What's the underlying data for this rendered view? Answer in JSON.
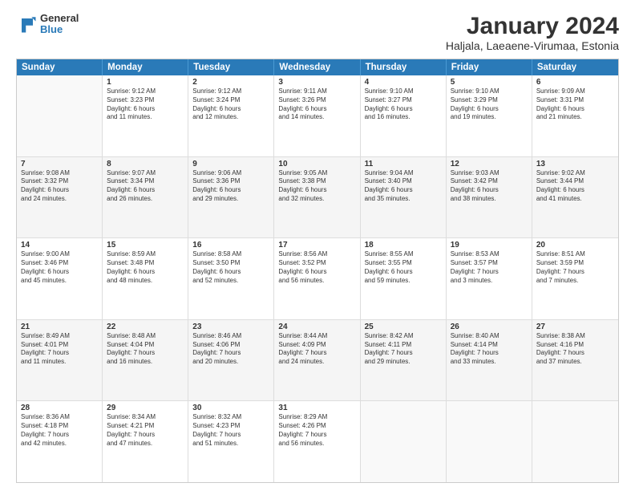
{
  "header": {
    "logo": {
      "general": "General",
      "blue": "Blue"
    },
    "title": "January 2024",
    "location": "Haljala, Laeaene-Virumaa, Estonia"
  },
  "calendar": {
    "days": [
      "Sunday",
      "Monday",
      "Tuesday",
      "Wednesday",
      "Thursday",
      "Friday",
      "Saturday"
    ],
    "rows": [
      [
        {
          "day": "",
          "info": ""
        },
        {
          "day": "1",
          "info": "Sunrise: 9:12 AM\nSunset: 3:23 PM\nDaylight: 6 hours\nand 11 minutes."
        },
        {
          "day": "2",
          "info": "Sunrise: 9:12 AM\nSunset: 3:24 PM\nDaylight: 6 hours\nand 12 minutes."
        },
        {
          "day": "3",
          "info": "Sunrise: 9:11 AM\nSunset: 3:26 PM\nDaylight: 6 hours\nand 14 minutes."
        },
        {
          "day": "4",
          "info": "Sunrise: 9:10 AM\nSunset: 3:27 PM\nDaylight: 6 hours\nand 16 minutes."
        },
        {
          "day": "5",
          "info": "Sunrise: 9:10 AM\nSunset: 3:29 PM\nDaylight: 6 hours\nand 19 minutes."
        },
        {
          "day": "6",
          "info": "Sunrise: 9:09 AM\nSunset: 3:31 PM\nDaylight: 6 hours\nand 21 minutes."
        }
      ],
      [
        {
          "day": "7",
          "info": "Sunrise: 9:08 AM\nSunset: 3:32 PM\nDaylight: 6 hours\nand 24 minutes."
        },
        {
          "day": "8",
          "info": "Sunrise: 9:07 AM\nSunset: 3:34 PM\nDaylight: 6 hours\nand 26 minutes."
        },
        {
          "day": "9",
          "info": "Sunrise: 9:06 AM\nSunset: 3:36 PM\nDaylight: 6 hours\nand 29 minutes."
        },
        {
          "day": "10",
          "info": "Sunrise: 9:05 AM\nSunset: 3:38 PM\nDaylight: 6 hours\nand 32 minutes."
        },
        {
          "day": "11",
          "info": "Sunrise: 9:04 AM\nSunset: 3:40 PM\nDaylight: 6 hours\nand 35 minutes."
        },
        {
          "day": "12",
          "info": "Sunrise: 9:03 AM\nSunset: 3:42 PM\nDaylight: 6 hours\nand 38 minutes."
        },
        {
          "day": "13",
          "info": "Sunrise: 9:02 AM\nSunset: 3:44 PM\nDaylight: 6 hours\nand 41 minutes."
        }
      ],
      [
        {
          "day": "14",
          "info": "Sunrise: 9:00 AM\nSunset: 3:46 PM\nDaylight: 6 hours\nand 45 minutes."
        },
        {
          "day": "15",
          "info": "Sunrise: 8:59 AM\nSunset: 3:48 PM\nDaylight: 6 hours\nand 48 minutes."
        },
        {
          "day": "16",
          "info": "Sunrise: 8:58 AM\nSunset: 3:50 PM\nDaylight: 6 hours\nand 52 minutes."
        },
        {
          "day": "17",
          "info": "Sunrise: 8:56 AM\nSunset: 3:52 PM\nDaylight: 6 hours\nand 56 minutes."
        },
        {
          "day": "18",
          "info": "Sunrise: 8:55 AM\nSunset: 3:55 PM\nDaylight: 6 hours\nand 59 minutes."
        },
        {
          "day": "19",
          "info": "Sunrise: 8:53 AM\nSunset: 3:57 PM\nDaylight: 7 hours\nand 3 minutes."
        },
        {
          "day": "20",
          "info": "Sunrise: 8:51 AM\nSunset: 3:59 PM\nDaylight: 7 hours\nand 7 minutes."
        }
      ],
      [
        {
          "day": "21",
          "info": "Sunrise: 8:49 AM\nSunset: 4:01 PM\nDaylight: 7 hours\nand 11 minutes."
        },
        {
          "day": "22",
          "info": "Sunrise: 8:48 AM\nSunset: 4:04 PM\nDaylight: 7 hours\nand 16 minutes."
        },
        {
          "day": "23",
          "info": "Sunrise: 8:46 AM\nSunset: 4:06 PM\nDaylight: 7 hours\nand 20 minutes."
        },
        {
          "day": "24",
          "info": "Sunrise: 8:44 AM\nSunset: 4:09 PM\nDaylight: 7 hours\nand 24 minutes."
        },
        {
          "day": "25",
          "info": "Sunrise: 8:42 AM\nSunset: 4:11 PM\nDaylight: 7 hours\nand 29 minutes."
        },
        {
          "day": "26",
          "info": "Sunrise: 8:40 AM\nSunset: 4:14 PM\nDaylight: 7 hours\nand 33 minutes."
        },
        {
          "day": "27",
          "info": "Sunrise: 8:38 AM\nSunset: 4:16 PM\nDaylight: 7 hours\nand 37 minutes."
        }
      ],
      [
        {
          "day": "28",
          "info": "Sunrise: 8:36 AM\nSunset: 4:18 PM\nDaylight: 7 hours\nand 42 minutes."
        },
        {
          "day": "29",
          "info": "Sunrise: 8:34 AM\nSunset: 4:21 PM\nDaylight: 7 hours\nand 47 minutes."
        },
        {
          "day": "30",
          "info": "Sunrise: 8:32 AM\nSunset: 4:23 PM\nDaylight: 7 hours\nand 51 minutes."
        },
        {
          "day": "31",
          "info": "Sunrise: 8:29 AM\nSunset: 4:26 PM\nDaylight: 7 hours\nand 56 minutes."
        },
        {
          "day": "",
          "info": ""
        },
        {
          "day": "",
          "info": ""
        },
        {
          "day": "",
          "info": ""
        }
      ]
    ]
  }
}
